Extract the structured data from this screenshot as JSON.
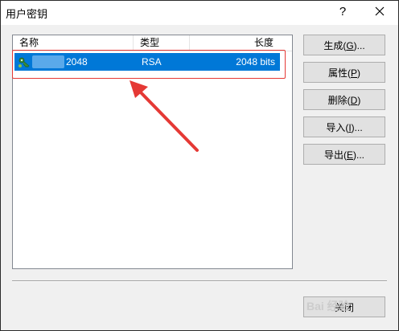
{
  "window": {
    "title": "用户密钥",
    "help": "?"
  },
  "list": {
    "columns": [
      "名称",
      "类型",
      "长度"
    ],
    "rows": [
      {
        "name": "2048",
        "type": "RSA",
        "length": "2048 bits"
      }
    ]
  },
  "buttons": [
    {
      "text": "生成(",
      "key": "G",
      "suffix": ")..."
    },
    {
      "text": "属性(",
      "key": "P",
      "suffix": ")"
    },
    {
      "text": "删除(",
      "key": "D",
      "suffix": ")"
    },
    {
      "text": "导入(",
      "key": "I",
      "suffix": ")..."
    },
    {
      "text": "导出(",
      "key": "E",
      "suffix": ")..."
    }
  ],
  "close_label": "关闭",
  "watermark": "Bai 经验",
  "colors": {
    "selection": "#0078d7",
    "annotation": "#e53935"
  },
  "icons": {
    "key": "key-icon",
    "close": "close-icon",
    "arrow": "annotation-arrow"
  }
}
